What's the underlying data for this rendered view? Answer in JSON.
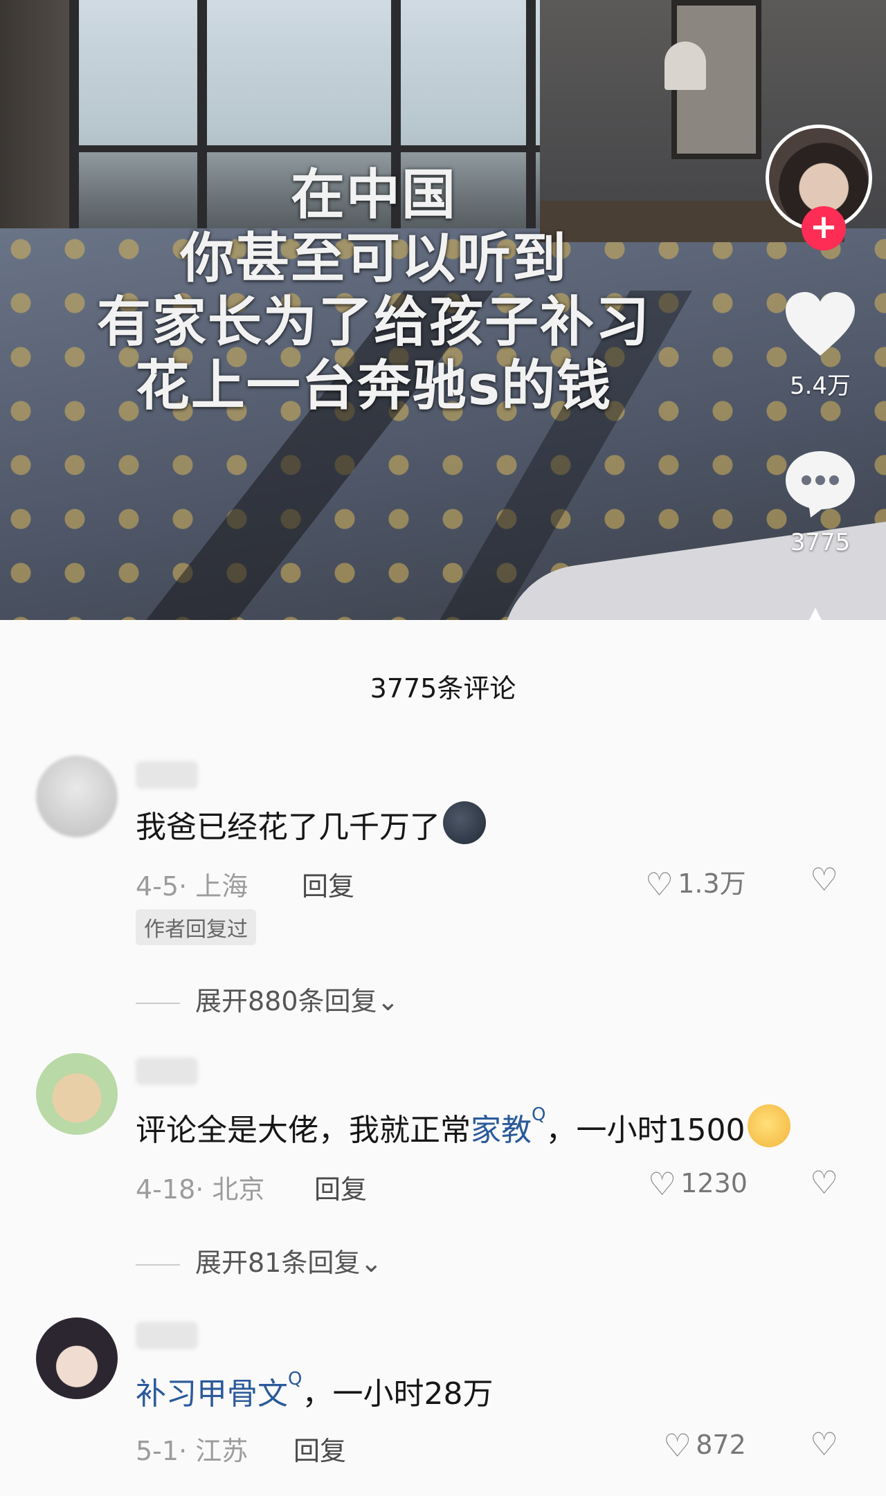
{
  "video": {
    "overlay_lines": [
      "在中国",
      "你甚至可以听到",
      "有家长为了给孩子补习",
      "花上一台奔驰s的钱"
    ]
  },
  "actions": {
    "follow_symbol": "+",
    "like_icon": "heart-icon",
    "like_count": "5.4万",
    "comment_icon": "comment-bubble-icon",
    "comment_count": "3775",
    "share_symbol": "▲"
  },
  "comments_panel": {
    "title": "3775条评论",
    "items": [
      {
        "text": "我爸已经花了几千万了",
        "emoji": "moon-face-emoji",
        "meta": "4-5· 上海",
        "reply_label": "回复",
        "likes": "1.3万",
        "author_badge": "作者回复过",
        "expand": "展开880条回复"
      },
      {
        "text_prefix": "评论全是大佬，我就正常",
        "link": "家教",
        "search_mark": "Q",
        "text_suffix": "，一小时1500",
        "emoji": "grin-sweat-emoji",
        "meta": "4-18· 北京",
        "reply_label": "回复",
        "likes": "1230",
        "expand": "展开81条回复"
      },
      {
        "link": "补习甲骨文",
        "search_mark": "Q",
        "text_suffix": "，一小时28万",
        "meta": "5-1· 江苏",
        "reply_label": "回复",
        "likes": "872"
      }
    ],
    "heart_glyph": "♡",
    "dislike_glyph": "♡",
    "chevron_glyph": "⌄"
  }
}
